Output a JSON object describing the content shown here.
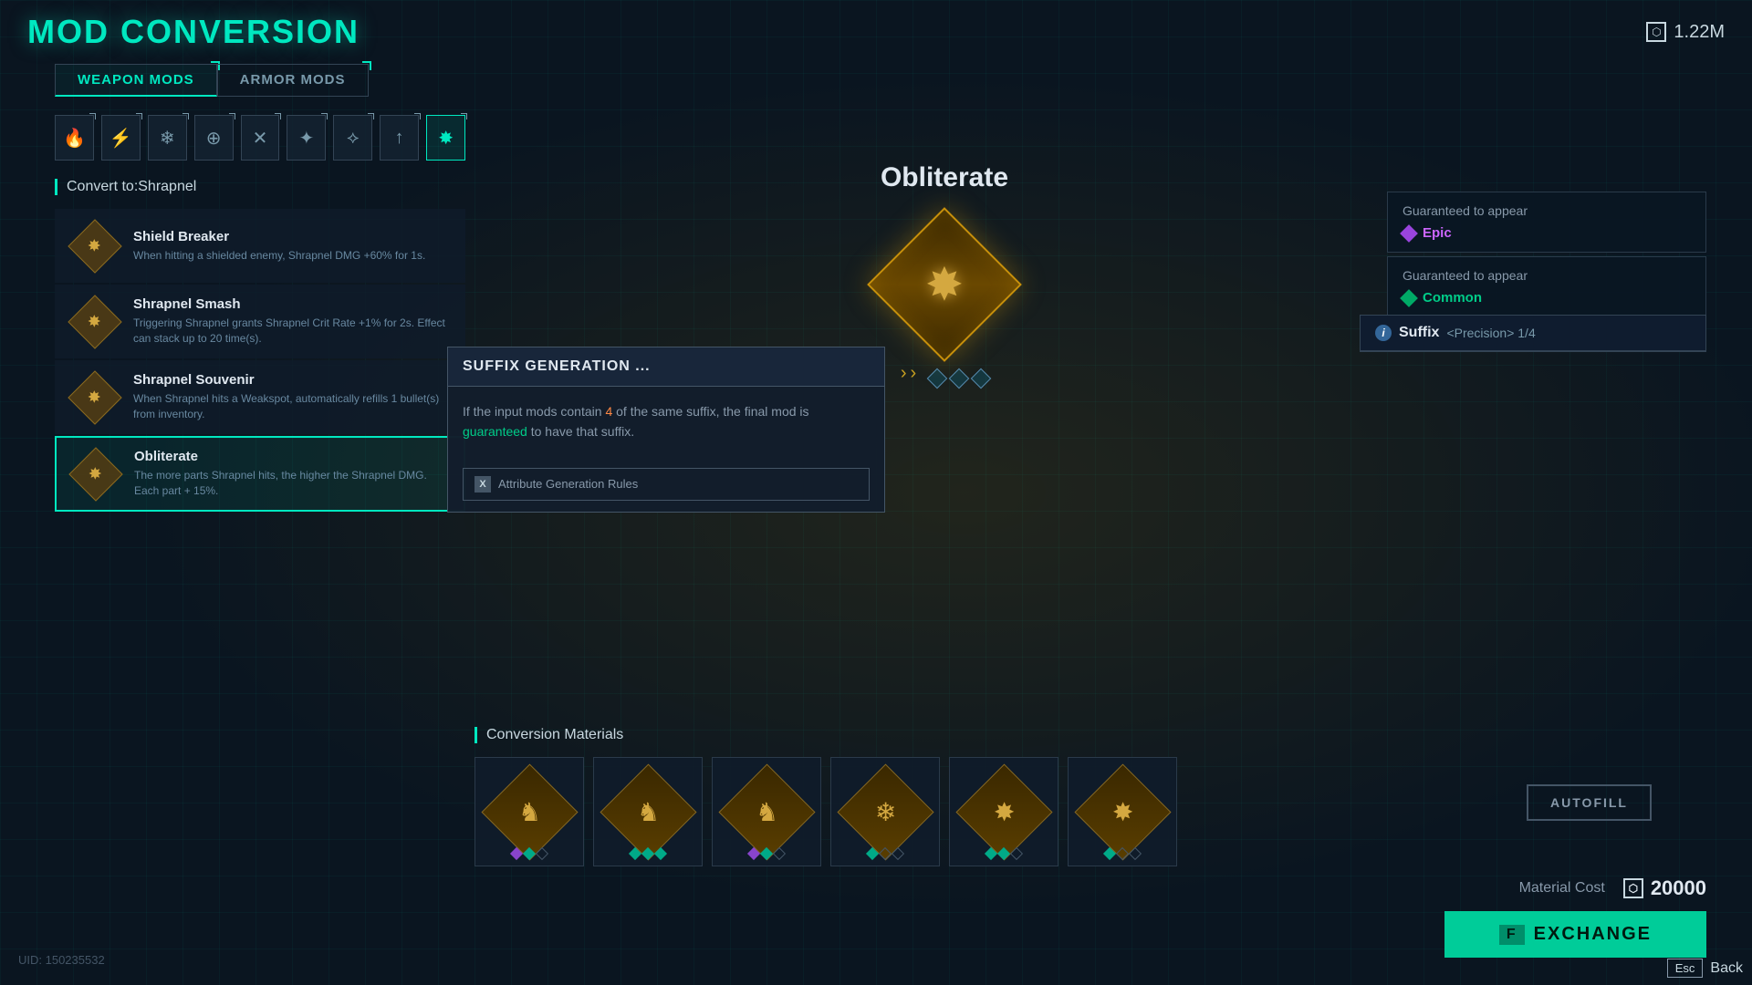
{
  "header": {
    "title": "MOD CONVERSION",
    "currency_value": "1.22M",
    "currency_icon": "⬡"
  },
  "tabs": [
    {
      "id": "weapon",
      "label": "WEAPON MODS",
      "active": true
    },
    {
      "id": "armor",
      "label": "ARMOR MODS",
      "active": false
    }
  ],
  "categories": [
    {
      "id": 0,
      "icon": "🔥",
      "active": false
    },
    {
      "id": 1,
      "icon": "⚡",
      "active": false
    },
    {
      "id": 2,
      "icon": "❄",
      "active": false
    },
    {
      "id": 3,
      "icon": "⊕",
      "active": false
    },
    {
      "id": 4,
      "icon": "⊗",
      "active": false
    },
    {
      "id": 5,
      "icon": "✦",
      "active": false
    },
    {
      "id": 6,
      "icon": "⟡",
      "active": false
    },
    {
      "id": 7,
      "icon": "↑",
      "active": false
    },
    {
      "id": 8,
      "icon": "★",
      "active": true
    }
  ],
  "convert_label": "Convert to:Shrapnel",
  "mods": [
    {
      "id": 0,
      "name": "Shield Breaker",
      "desc": "When hitting a shielded enemy, Shrapnel DMG +60% for 1s.",
      "selected": false
    },
    {
      "id": 1,
      "name": "Shrapnel Smash",
      "desc": "Triggering Shrapnel grants Shrapnel Crit Rate +1% for 2s. Effect can stack up to 20 time(s).",
      "selected": false
    },
    {
      "id": 2,
      "name": "Shrapnel Souvenir",
      "desc": "When Shrapnel hits a Weakspot, automatically refills 1 bullet(s) from inventory.",
      "selected": false
    },
    {
      "id": 3,
      "name": "Obliterate",
      "desc": "The more parts Shrapnel hits, the higher the Shrapnel DMG. Each part + 15%.",
      "selected": true
    }
  ],
  "center": {
    "mod_name": "Obliterate",
    "slots": [
      {
        "color": "blue"
      },
      {
        "color": "blue"
      },
      {
        "color": "blue"
      }
    ]
  },
  "guaranteed": [
    {
      "label": "Guaranteed to appear",
      "rarity": "Epic",
      "rarity_type": "epic"
    },
    {
      "label": "Guaranteed to appear",
      "rarity": "Common",
      "rarity_type": "common"
    }
  ],
  "suffix": {
    "title": "Suffix",
    "value": "<Precision>  1/4"
  },
  "suffix_gen": {
    "header": "SUFFIX GENERATION ...",
    "body_part1": "If the input mods contain ",
    "body_number": "4",
    "body_part2": " of the same suffix, the final mod is ",
    "body_highlight": "guaranteed",
    "body_part3": " to have that suffix.",
    "button": "Attribute Generation Rules"
  },
  "autofill": {
    "label": "AUTOFILL"
  },
  "materials": {
    "label": "Conversion Materials",
    "items": [
      {
        "id": 0,
        "slots": [
          "purple",
          "teal",
          "empty"
        ]
      },
      {
        "id": 1,
        "slots": [
          "teal",
          "teal",
          "teal"
        ]
      },
      {
        "id": 2,
        "slots": [
          "purple",
          "teal",
          "empty"
        ]
      },
      {
        "id": 3,
        "slots": [
          "teal",
          "empty",
          "empty"
        ]
      },
      {
        "id": 4,
        "slots": [
          "teal",
          "teal",
          "empty"
        ]
      },
      {
        "id": 5,
        "slots": [
          "teal",
          "empty",
          "empty"
        ]
      }
    ]
  },
  "footer": {
    "material_cost_label": "Material Cost",
    "material_cost_value": "20000",
    "exchange_label": "EXCHANGE",
    "exchange_key": "F",
    "back_label": "Back",
    "back_key": "Esc",
    "uid": "UID: 150235532"
  }
}
